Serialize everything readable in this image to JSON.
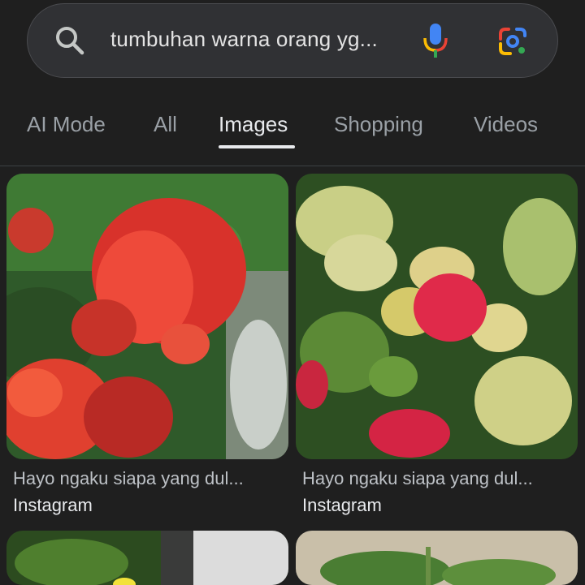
{
  "search": {
    "query": "tumbuhan warna orang yg..."
  },
  "tabs": [
    {
      "label": "AI Mode"
    },
    {
      "label": "All"
    },
    {
      "label": "Images",
      "active": true
    },
    {
      "label": "Shopping"
    },
    {
      "label": "Videos"
    }
  ],
  "results": [
    {
      "title": "Hayo ngaku siapa yang dul...",
      "source": "Instagram"
    },
    {
      "title": "Hayo ngaku siapa yang dul...",
      "source": "Instagram"
    }
  ],
  "icons": [
    "search-icon",
    "mic-icon",
    "google-lens-icon"
  ],
  "colors": {
    "background": "#1f1f1f",
    "search_bg": "#303134",
    "active_tab": "#e8eaed",
    "inactive_tab": "#9aa0a6"
  }
}
